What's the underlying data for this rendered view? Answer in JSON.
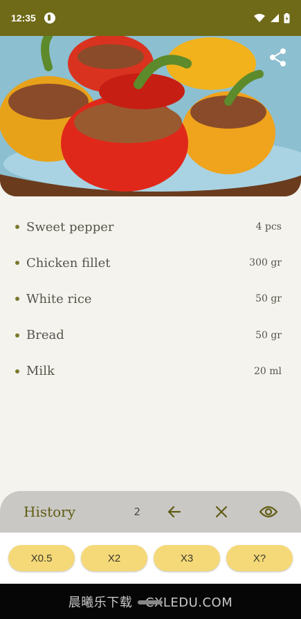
{
  "status_bar": {
    "time": "12:35",
    "icons": [
      "app-icon",
      "wifi-icon",
      "signal-icon",
      "battery-icon"
    ]
  },
  "hero": {
    "image_desc_icon": "stuffed-peppers-photo",
    "share_icon": "share-icon"
  },
  "ingredients": [
    {
      "name": "Sweet pepper",
      "amount": "4 pcs"
    },
    {
      "name": "Chicken fillet",
      "amount": "300 gr"
    },
    {
      "name": "White rice",
      "amount": "50 gr"
    },
    {
      "name": "Bread",
      "amount": "50 gr"
    },
    {
      "name": "Milk",
      "amount": "20 ml"
    }
  ],
  "history": {
    "label": "History",
    "count": "2",
    "back_icon": "arrow-left-icon",
    "clear_icon": "close-icon",
    "view_icon": "eye-icon"
  },
  "multipliers": [
    "X0.5",
    "X2",
    "X3",
    "X?"
  ],
  "nav": {
    "watermark": "晨曦乐下载 · CXLEDU.COM"
  },
  "colors": {
    "status_bar": "#6f6a17",
    "accent": "#5f5b14",
    "button": "#f5d979",
    "background": "#f5f3ee",
    "history_panel": "#c9c8c4"
  }
}
